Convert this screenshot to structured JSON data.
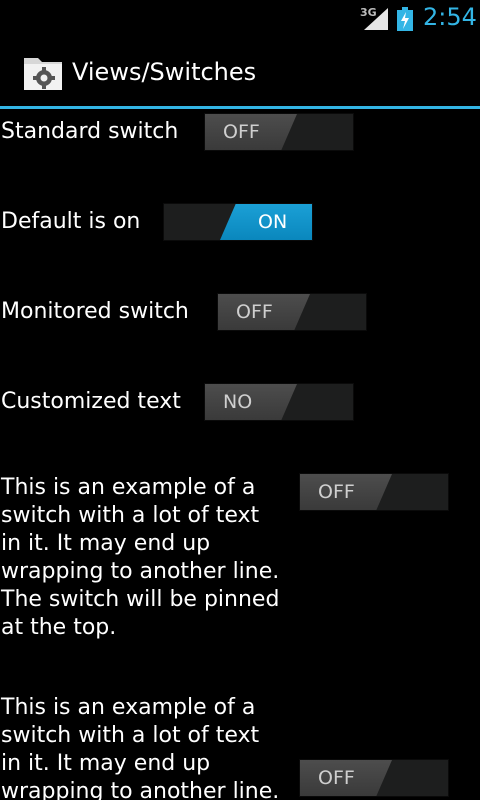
{
  "status_bar": {
    "network": "3G",
    "time": "2:54",
    "signal_icon": "signal-strength-icon",
    "battery_icon": "battery-charging-icon"
  },
  "action_bar": {
    "title": "Views/Switches",
    "icon": "settings-folder-icon"
  },
  "colors": {
    "accent": "#33b5e5",
    "switch_on": "#0a87bd",
    "background": "#000000"
  },
  "rows": [
    {
      "label": "Standard switch",
      "state": "OFF",
      "on": false
    },
    {
      "label": "Default is on",
      "state": "ON",
      "on": true
    },
    {
      "label": "Monitored switch",
      "state": "OFF",
      "on": false
    },
    {
      "label": "Customized text",
      "state": "NO",
      "on": false
    },
    {
      "label": "This is an example of a switch with a lot of text in it. It may end up wrapping to another line. The switch will be pinned at the top.",
      "state": "OFF",
      "on": false
    },
    {
      "label": "This is an example of a switch with a lot of text in it. It may end up wrapping to another line.",
      "state": "OFF",
      "on": false
    }
  ]
}
